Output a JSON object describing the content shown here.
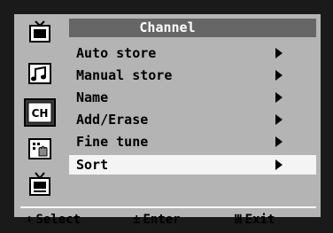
{
  "menu": {
    "title": "Channel",
    "items": [
      {
        "label": "Auto store"
      },
      {
        "label": "Manual store"
      },
      {
        "label": "Name"
      },
      {
        "label": "Add/Erase"
      },
      {
        "label": "Fine tune"
      },
      {
        "label": "Sort"
      }
    ],
    "selected_item": "Sort"
  },
  "sidebar": {
    "items": [
      {
        "icon": "picture-icon",
        "selected": false
      },
      {
        "icon": "sound-icon",
        "selected": false
      },
      {
        "icon": "channel-icon",
        "label": "CH",
        "selected": true
      },
      {
        "icon": "function-icon",
        "selected": false
      },
      {
        "icon": "pip-icon",
        "selected": false
      }
    ]
  },
  "footer": {
    "select_label": "Select",
    "enter_label": "Enter",
    "exit_label": "Exit",
    "select_glyph": "⬍",
    "enter_glyph": "±",
    "exit_glyph": "Ⅲ"
  },
  "colors": {
    "background": "#b4b4b4",
    "title_bar": "#666666",
    "selected_row": "#f4f4f4",
    "outer": "#1a1a1a"
  }
}
